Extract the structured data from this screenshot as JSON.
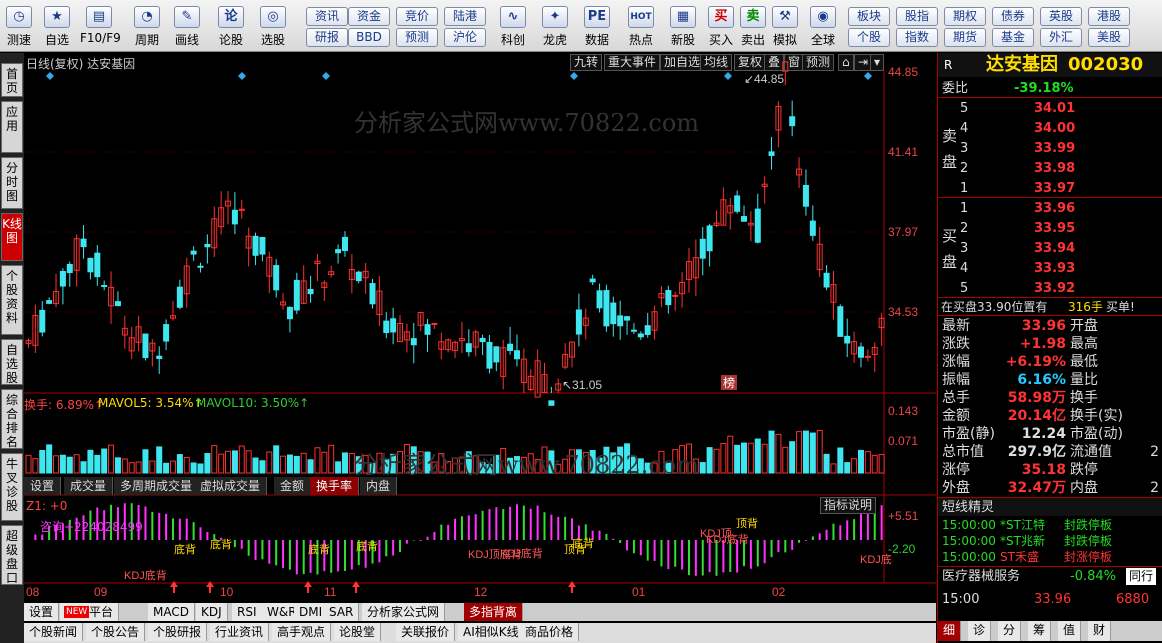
{
  "toolbar": {
    "buttons": [
      {
        "label": "测速",
        "icon": "speed-icon",
        "glyph": "◷"
      },
      {
        "label": "自选",
        "icon": "star-icon",
        "glyph": "★"
      },
      {
        "label": "F10/F9",
        "icon": "f10-icon",
        "glyph": "▤"
      },
      {
        "label": "周期",
        "icon": "clock-icon",
        "glyph": "◔"
      },
      {
        "label": "画线",
        "icon": "pencil-icon",
        "glyph": "✎"
      },
      {
        "label": "论股",
        "icon": "discuss-icon",
        "glyph": "论"
      },
      {
        "label": "选股",
        "icon": "select-stock-icon",
        "glyph": "◎"
      }
    ],
    "pills": [
      "资讯",
      "资金",
      "竞价",
      "陆港",
      "研报",
      "BBD",
      "预测",
      "沪伦"
    ],
    "buttons2": [
      {
        "label": "科创",
        "icon": "kechuang-icon",
        "glyph": "∿"
      },
      {
        "label": "龙虎",
        "icon": "dragon-icon",
        "glyph": "✦"
      },
      {
        "label": "数据",
        "icon": "data-icon",
        "glyph": "PE"
      },
      {
        "label": "热点",
        "icon": "hot-icon",
        "glyph": "HOT"
      },
      {
        "label": "新股",
        "icon": "new-stock-icon",
        "glyph": "▦"
      },
      {
        "label": "买入",
        "icon": "buy-icon",
        "glyph": "买"
      },
      {
        "label": "卖出",
        "icon": "sell-icon",
        "glyph": "卖"
      },
      {
        "label": "模拟",
        "icon": "hammer-icon",
        "glyph": "⚒"
      },
      {
        "label": "全球",
        "icon": "globe-icon",
        "glyph": "◉"
      }
    ],
    "pills2": [
      "板块",
      "股指",
      "期权",
      "债券",
      "英股",
      "港股",
      "个股",
      "指数",
      "期货",
      "基金",
      "外汇",
      "美股"
    ]
  },
  "left_tabs": [
    "首页",
    "应用",
    "分时图",
    "K线图",
    "个股资料",
    "自选股",
    "综合排名",
    "牛叉诊股",
    "超级盘口"
  ],
  "chart": {
    "title": "日线(复权)  达安基因",
    "buttons": [
      "九转",
      "重大事件",
      "加自选",
      "均线",
      "复权",
      "叠",
      "窗",
      "预测"
    ],
    "price_ticks": [
      "44.85",
      "41.41",
      "37.97",
      "34.53"
    ],
    "high_label": "44.85",
    "low_label": "31.05",
    "bang": "榜",
    "watermark": "分析家公式网www.70822.com",
    "vol_header": {
      "a": "换手: 6.89%↑",
      "b": "MAVOL5: 3.54%↑",
      "c": "MAVOL10: 3.50%↑"
    },
    "vol_ticks": [
      "0.143",
      "0.071"
    ],
    "sub_tabs": [
      "设置",
      "成交量",
      "多周期成交量",
      "虚拟成交量",
      "金额",
      "换手率",
      "内盘"
    ],
    "ind_header": "Z1: +0",
    "ind_button": "指标说明",
    "ind_ticks": [
      "+5.51",
      "-2.20"
    ],
    "ind_note": "咨询+224028499",
    "ind_labels": [
      "KDJ底背",
      "底背",
      "底背",
      "底背",
      "底背",
      "KDJ顶底背",
      "KDJ底背",
      "顶背",
      "底背",
      "KDJ顶",
      "KDJ底背",
      "顶背",
      "KDJ底"
    ],
    "months": [
      "08",
      "09",
      "10",
      "11",
      "12",
      "01",
      "02"
    ]
  },
  "bottom_tabs": [
    "设置",
    "指标平台",
    "MACD",
    "KDJ",
    "RSI",
    "W&R",
    "DMI",
    "SAR",
    "分析家公式网",
    "多指背离"
  ],
  "new_badge": "NEW",
  "bottom_tabs2": [
    "个股新闻",
    "个股公告",
    "个股研报",
    "行业资讯",
    "高手观点",
    "论股堂",
    "关联报价",
    "AI相似K线",
    "商品价格"
  ],
  "quote": {
    "r": "R",
    "name": "达安基因",
    "code": "002030",
    "weibi_label": "委比",
    "weibi": "-39.18%",
    "sell_label": "卖盘",
    "buy_label": "买盘",
    "sells": [
      {
        "n": "5",
        "p": "34.01"
      },
      {
        "n": "4",
        "p": "34.00"
      },
      {
        "n": "3",
        "p": "33.99"
      },
      {
        "n": "2",
        "p": "33.98"
      },
      {
        "n": "1",
        "p": "33.97"
      }
    ],
    "buys": [
      {
        "n": "1",
        "p": "33.96"
      },
      {
        "n": "2",
        "p": "33.95"
      },
      {
        "n": "3",
        "p": "33.94"
      },
      {
        "n": "4",
        "p": "33.93"
      },
      {
        "n": "5",
        "p": "33.92"
      }
    ],
    "tip_a": "在买盘33.90位置有",
    "tip_b": "316手",
    "tip_c": "买单!",
    "stats": [
      {
        "k": "最新",
        "v": "33.96",
        "k2": "开盘",
        "v2": ""
      },
      {
        "k": "涨跌",
        "v": "+1.98",
        "k2": "最高",
        "v2": ""
      },
      {
        "k": "涨幅",
        "v": "+6.19%",
        "k2": "最低",
        "v2": ""
      },
      {
        "k": "振幅",
        "v": "6.16%",
        "k2": "量比",
        "v2": ""
      },
      {
        "k": "总手",
        "v": "58.98万",
        "k2": "换手",
        "v2": ""
      },
      {
        "k": "金额",
        "v": "20.14亿",
        "k2": "换手(实)",
        "v2": ""
      },
      {
        "k": "市盈(静)",
        "v": "12.24",
        "k2": "市盈(动)",
        "v2": ""
      },
      {
        "k": "总市值",
        "v": "297.9亿",
        "k2": "流通值",
        "v2": "2"
      },
      {
        "k": "涨停",
        "v": "35.18",
        "k2": "跌停",
        "v2": ""
      },
      {
        "k": "外盘",
        "v": "32.47万",
        "k2": "内盘",
        "v2": "2"
      }
    ],
    "elf_title": "短线精灵",
    "elf": [
      {
        "t": "15:00:00",
        "s": "*ST江特",
        "e": "封跌停板"
      },
      {
        "t": "15:00:00",
        "s": "*ST兆新",
        "e": "封跌停板"
      },
      {
        "t": "15:00:00",
        "s": "ST禾盛",
        "e": "封涨停板"
      }
    ],
    "sector": "医疗器械服务",
    "sector_chg": "-0.84%",
    "sector_btn": "同行",
    "tick_time": "15:00",
    "tick_price": "33.96",
    "tick_vol": "6880",
    "tabs": [
      "细",
      "诊",
      "分",
      "筹",
      "值",
      "财"
    ]
  },
  "colors": {
    "up": "#ff3030",
    "down": "#3ee6f0",
    "ma5": "#ffffff",
    "ma10": "#ffdd33",
    "bg": "#000000"
  }
}
